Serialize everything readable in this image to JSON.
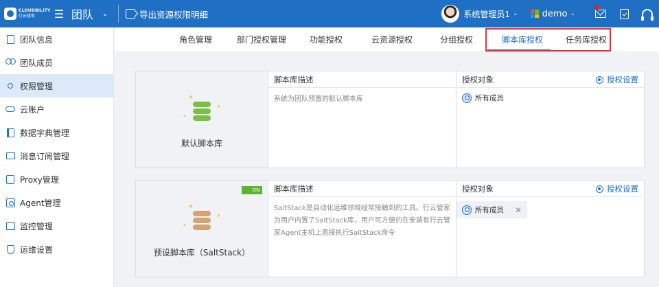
{
  "header": {
    "logo_en": "CLOUDBILITY",
    "logo_cn": "行云管家",
    "title": "团队",
    "export_label": "导出资源权限明细",
    "user_name": "系统管理员1",
    "tenant": "demo"
  },
  "sidebar": {
    "items": [
      {
        "label": "团队信息",
        "icon": "document-icon"
      },
      {
        "label": "团队成员",
        "icon": "users-icon"
      },
      {
        "label": "权限管理",
        "icon": "user-settings-icon",
        "active": true
      },
      {
        "label": "云账户",
        "icon": "cloud-icon"
      },
      {
        "label": "数据字典管理",
        "icon": "book-icon"
      },
      {
        "label": "消息订阅管理",
        "icon": "mail-icon"
      },
      {
        "label": "Proxy管理",
        "icon": "proxy-icon"
      },
      {
        "label": "Agent管理",
        "icon": "agent-icon"
      },
      {
        "label": "监控管理",
        "icon": "monitor-icon"
      },
      {
        "label": "运维设置",
        "icon": "shield-icon"
      }
    ]
  },
  "tabs": [
    {
      "label": "角色管理"
    },
    {
      "label": "部门授权管理"
    },
    {
      "label": "功能授权"
    },
    {
      "label": "云资源授权"
    },
    {
      "label": "分组授权"
    },
    {
      "label": "脚本库授权",
      "active": true
    },
    {
      "label": "任务库授权"
    }
  ],
  "cards": [
    {
      "name": "默认脚本库",
      "desc_header": "脚本库描述",
      "auth_header": "授权对象",
      "auth_setting": "授权设置",
      "description": "系统为团队预置的默认脚本库",
      "member": "所有成员",
      "db_color": "#7ac143"
    },
    {
      "name": "预设脚本库（SaltStack）",
      "desc_header": "脚本库描述",
      "auth_header": "授权对象",
      "auth_setting": "授权设置",
      "description": "SaltStack是自动化运维领域经常接触到的工具。行云管家为用户内置了SaltStack库，用户可方便的在安装有行云管家Agent主机上直接执行SaltStack命令",
      "member": "所有成员",
      "toggle": "ON",
      "db_color": "#d4a373"
    }
  ],
  "colors": {
    "brand": "#1f6fc5",
    "highlight": "#e5323a",
    "toggle_on": "#5fb333"
  }
}
